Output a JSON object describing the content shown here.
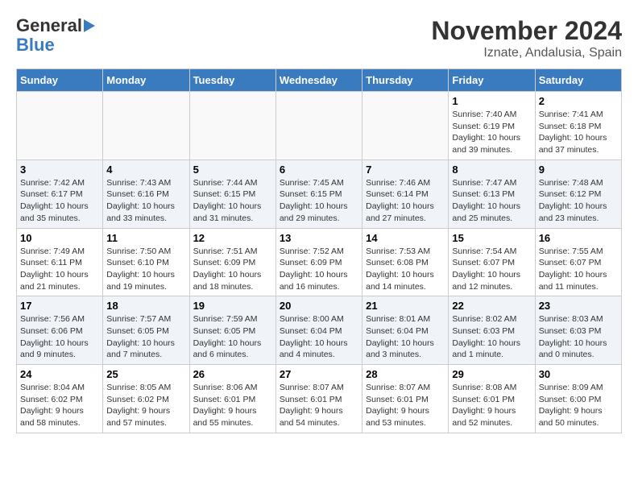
{
  "header": {
    "logo_line1": "General",
    "logo_line2": "Blue",
    "month": "November 2024",
    "location": "Iznate, Andalusia, Spain"
  },
  "weekdays": [
    "Sunday",
    "Monday",
    "Tuesday",
    "Wednesday",
    "Thursday",
    "Friday",
    "Saturday"
  ],
  "weeks": [
    [
      {
        "day": "",
        "info": ""
      },
      {
        "day": "",
        "info": ""
      },
      {
        "day": "",
        "info": ""
      },
      {
        "day": "",
        "info": ""
      },
      {
        "day": "",
        "info": ""
      },
      {
        "day": "1",
        "info": "Sunrise: 7:40 AM\nSunset: 6:19 PM\nDaylight: 10 hours and 39 minutes."
      },
      {
        "day": "2",
        "info": "Sunrise: 7:41 AM\nSunset: 6:18 PM\nDaylight: 10 hours and 37 minutes."
      }
    ],
    [
      {
        "day": "3",
        "info": "Sunrise: 7:42 AM\nSunset: 6:17 PM\nDaylight: 10 hours and 35 minutes."
      },
      {
        "day": "4",
        "info": "Sunrise: 7:43 AM\nSunset: 6:16 PM\nDaylight: 10 hours and 33 minutes."
      },
      {
        "day": "5",
        "info": "Sunrise: 7:44 AM\nSunset: 6:15 PM\nDaylight: 10 hours and 31 minutes."
      },
      {
        "day": "6",
        "info": "Sunrise: 7:45 AM\nSunset: 6:15 PM\nDaylight: 10 hours and 29 minutes."
      },
      {
        "day": "7",
        "info": "Sunrise: 7:46 AM\nSunset: 6:14 PM\nDaylight: 10 hours and 27 minutes."
      },
      {
        "day": "8",
        "info": "Sunrise: 7:47 AM\nSunset: 6:13 PM\nDaylight: 10 hours and 25 minutes."
      },
      {
        "day": "9",
        "info": "Sunrise: 7:48 AM\nSunset: 6:12 PM\nDaylight: 10 hours and 23 minutes."
      }
    ],
    [
      {
        "day": "10",
        "info": "Sunrise: 7:49 AM\nSunset: 6:11 PM\nDaylight: 10 hours and 21 minutes."
      },
      {
        "day": "11",
        "info": "Sunrise: 7:50 AM\nSunset: 6:10 PM\nDaylight: 10 hours and 19 minutes."
      },
      {
        "day": "12",
        "info": "Sunrise: 7:51 AM\nSunset: 6:09 PM\nDaylight: 10 hours and 18 minutes."
      },
      {
        "day": "13",
        "info": "Sunrise: 7:52 AM\nSunset: 6:09 PM\nDaylight: 10 hours and 16 minutes."
      },
      {
        "day": "14",
        "info": "Sunrise: 7:53 AM\nSunset: 6:08 PM\nDaylight: 10 hours and 14 minutes."
      },
      {
        "day": "15",
        "info": "Sunrise: 7:54 AM\nSunset: 6:07 PM\nDaylight: 10 hours and 12 minutes."
      },
      {
        "day": "16",
        "info": "Sunrise: 7:55 AM\nSunset: 6:07 PM\nDaylight: 10 hours and 11 minutes."
      }
    ],
    [
      {
        "day": "17",
        "info": "Sunrise: 7:56 AM\nSunset: 6:06 PM\nDaylight: 10 hours and 9 minutes."
      },
      {
        "day": "18",
        "info": "Sunrise: 7:57 AM\nSunset: 6:05 PM\nDaylight: 10 hours and 7 minutes."
      },
      {
        "day": "19",
        "info": "Sunrise: 7:59 AM\nSunset: 6:05 PM\nDaylight: 10 hours and 6 minutes."
      },
      {
        "day": "20",
        "info": "Sunrise: 8:00 AM\nSunset: 6:04 PM\nDaylight: 10 hours and 4 minutes."
      },
      {
        "day": "21",
        "info": "Sunrise: 8:01 AM\nSunset: 6:04 PM\nDaylight: 10 hours and 3 minutes."
      },
      {
        "day": "22",
        "info": "Sunrise: 8:02 AM\nSunset: 6:03 PM\nDaylight: 10 hours and 1 minute."
      },
      {
        "day": "23",
        "info": "Sunrise: 8:03 AM\nSunset: 6:03 PM\nDaylight: 10 hours and 0 minutes."
      }
    ],
    [
      {
        "day": "24",
        "info": "Sunrise: 8:04 AM\nSunset: 6:02 PM\nDaylight: 9 hours and 58 minutes."
      },
      {
        "day": "25",
        "info": "Sunrise: 8:05 AM\nSunset: 6:02 PM\nDaylight: 9 hours and 57 minutes."
      },
      {
        "day": "26",
        "info": "Sunrise: 8:06 AM\nSunset: 6:01 PM\nDaylight: 9 hours and 55 minutes."
      },
      {
        "day": "27",
        "info": "Sunrise: 8:07 AM\nSunset: 6:01 PM\nDaylight: 9 hours and 54 minutes."
      },
      {
        "day": "28",
        "info": "Sunrise: 8:07 AM\nSunset: 6:01 PM\nDaylight: 9 hours and 53 minutes."
      },
      {
        "day": "29",
        "info": "Sunrise: 8:08 AM\nSunset: 6:01 PM\nDaylight: 9 hours and 52 minutes."
      },
      {
        "day": "30",
        "info": "Sunrise: 8:09 AM\nSunset: 6:00 PM\nDaylight: 9 hours and 50 minutes."
      }
    ]
  ]
}
